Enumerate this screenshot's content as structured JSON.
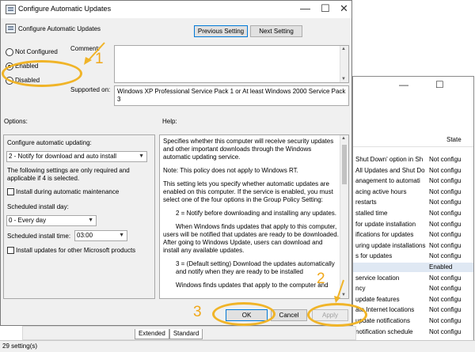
{
  "dialog": {
    "title": "Configure Automatic Updates",
    "setting_name": "Configure Automatic Updates",
    "previous_setting": "Previous Setting",
    "next_setting": "Next Setting",
    "radios": {
      "not_configured": "Not Configured",
      "enabled": "Enabled",
      "disabled": "Disabled",
      "selected": "enabled"
    },
    "comment_label": "Comment:",
    "supported_on_label": "Supported on:",
    "supported_on_value": "Windows XP Professional Service Pack 1 or At least Windows 2000 Service Pack 3",
    "options_label": "Options:",
    "help_label": "Help:",
    "options": {
      "configure_label": "Configure automatic updating:",
      "configure_value": "2 - Notify for download and auto install",
      "note": "The following settings are only required and applicable if 4 is selected.",
      "install_during_maintenance": "Install during automatic maintenance",
      "scheduled_day_label": "Scheduled install day:",
      "scheduled_day_value": "0 - Every day",
      "scheduled_time_label": "Scheduled install time:",
      "scheduled_time_value": "03:00",
      "install_other_products": "Install updates for other Microsoft products"
    },
    "help_text": [
      "Specifies whether this computer will receive security updates and other important downloads through the Windows automatic updating service.",
      "Note: This policy does not apply to Windows RT.",
      "This setting lets you specify whether automatic updates are enabled on this computer. If the service is enabled, you must select one of the four options in the Group Policy Setting:",
      "2 = Notify before downloading and installing any updates.",
      "When Windows finds updates that apply to this computer, users will be notified that updates are ready to be downloaded. After going to Windows Update, users can download and install any available updates.",
      "3 = (Default setting) Download the updates automatically and notify when they are ready to be installed",
      "Windows finds updates that apply to the computer and"
    ],
    "ok": "OK",
    "cancel": "Cancel",
    "apply": "Apply"
  },
  "background": {
    "state_header": "State",
    "rows": [
      {
        "name": "Shut Down' option in Sh",
        "state": "Not configu"
      },
      {
        "name": "All Updates and Shut Do",
        "state": "Not configu"
      },
      {
        "name": "anagement to automati",
        "state": "Not configu"
      },
      {
        "name": "acing active hours",
        "state": "Not configu"
      },
      {
        "name": "restarts",
        "state": "Not configu"
      },
      {
        "name": "stalled time",
        "state": "Not configu"
      },
      {
        "name": "for update installation",
        "state": "Not configu"
      },
      {
        "name": "ifications for updates",
        "state": "Not configu"
      },
      {
        "name": "uring update installations",
        "state": "Not configu"
      },
      {
        "name": "s for updates",
        "state": "Not configu"
      },
      {
        "name": "",
        "state": "Enabled",
        "selected": true
      },
      {
        "name": "service location",
        "state": "Not configu"
      },
      {
        "name": "ncy",
        "state": "Not configu"
      },
      {
        "name": "update features",
        "state": "Not configu"
      },
      {
        "name": "ate Internet locations",
        "state": "Not configu"
      },
      {
        "name": "update notifications",
        "state": "Not configu"
      },
      {
        "name": "notification schedule",
        "state": "Not configu"
      }
    ],
    "tabs": [
      "Extended",
      "Standard"
    ],
    "status": "29 setting(s)"
  },
  "annotations": [
    "1",
    "2",
    "3"
  ]
}
